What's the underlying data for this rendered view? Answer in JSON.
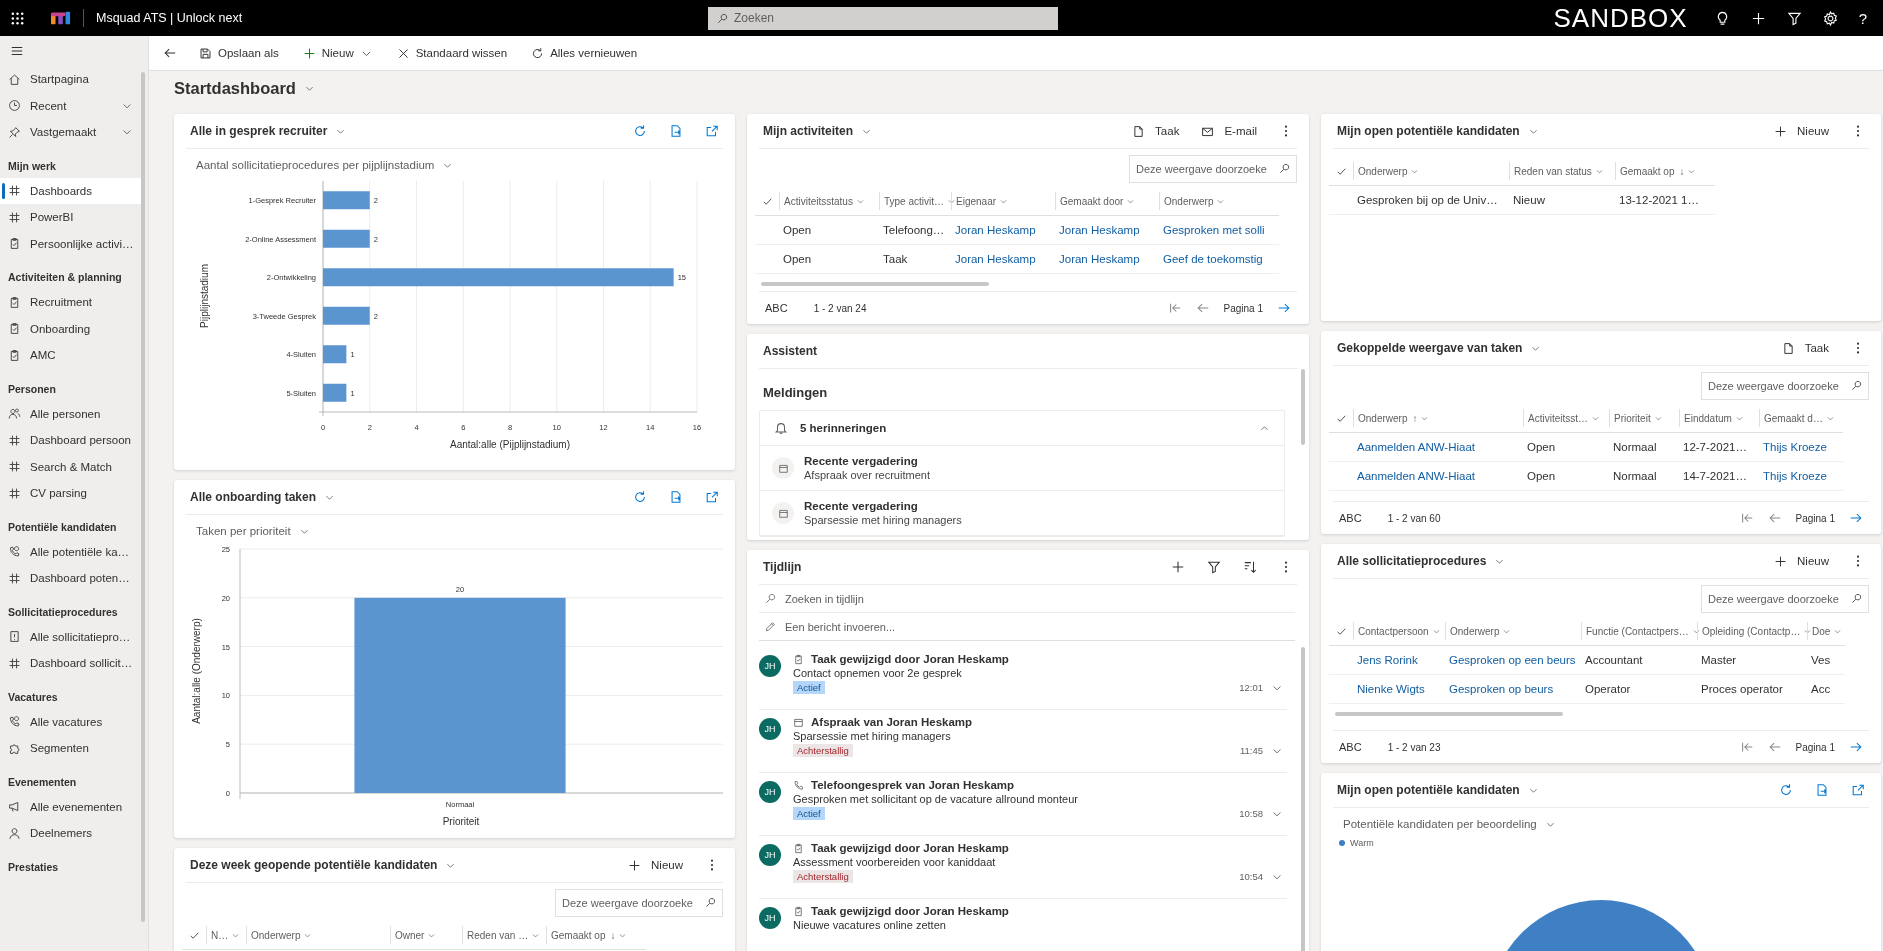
{
  "top_bar": {
    "app_name": "Msquad ATS | Unlock next",
    "search_placeholder": "Zoeken",
    "environment": "SANDBOX",
    "help": "?"
  },
  "command_bar": [
    {
      "label": "Opslaan als",
      "kind": "save",
      "has_menu": false
    },
    {
      "label": "Nieuw",
      "kind": "new",
      "has_menu": true
    },
    {
      "label": "Standaard wissen",
      "kind": "clear",
      "has_menu": false
    },
    {
      "label": "Alles vernieuwen",
      "kind": "refresh",
      "has_menu": false
    }
  ],
  "sidebar": {
    "top_items": [
      {
        "label": "Startpagina",
        "kind": "home",
        "has_menu": false
      },
      {
        "label": "Recent",
        "kind": "clock",
        "has_menu": true
      },
      {
        "label": "Vastgemaakt",
        "kind": "pin",
        "has_menu": true
      }
    ],
    "groups": [
      {
        "title": "Mijn werk",
        "items": [
          {
            "label": "Dashboards",
            "kind": "grid",
            "selected": true
          },
          {
            "label": "PowerBI",
            "kind": "grid",
            "selected": false
          },
          {
            "label": "Persoonlijke activi…",
            "kind": "clipboard",
            "selected": false
          }
        ]
      },
      {
        "title": "Activiteiten & planning",
        "items": [
          {
            "label": "Recruitment",
            "kind": "clipboard",
            "selected": false
          },
          {
            "label": "Onboarding",
            "kind": "clipboard",
            "selected": false
          },
          {
            "label": "AMC",
            "kind": "clipboard",
            "selected": false
          }
        ]
      },
      {
        "title": "Personen",
        "items": [
          {
            "label": "Alle personen",
            "kind": "people",
            "selected": false
          },
          {
            "label": "Dashboard persoon",
            "kind": "grid",
            "selected": false
          },
          {
            "label": "Search & Match",
            "kind": "grid",
            "selected": false
          },
          {
            "label": "CV parsing",
            "kind": "grid",
            "selected": false
          }
        ]
      },
      {
        "title": "Potentiële kandidaten",
        "items": [
          {
            "label": "Alle potentiële ka…",
            "kind": "contact",
            "selected": false
          },
          {
            "label": "Dashboard poten…",
            "kind": "grid",
            "selected": false
          }
        ]
      },
      {
        "title": "Sollicitatieprocedures",
        "items": [
          {
            "label": "Alle sollicitatiepro…",
            "kind": "alertdoc",
            "selected": false
          },
          {
            "label": "Dashboard sollicit…",
            "kind": "grid",
            "selected": false
          }
        ]
      },
      {
        "title": "Vacatures",
        "items": [
          {
            "label": "Alle vacatures",
            "kind": "contact",
            "selected": false
          },
          {
            "label": "Segmenten",
            "kind": "puzzle",
            "selected": false
          }
        ]
      },
      {
        "title": "Evenementen",
        "items": [
          {
            "label": "Alle evenementen",
            "kind": "megaphone",
            "selected": false
          },
          {
            "label": "Deelnemers",
            "kind": "person",
            "selected": false
          }
        ]
      },
      {
        "title": "Prestaties"
      }
    ]
  },
  "page_title": "Startdashboard",
  "columns": [
    {
      "cards": [
        {
          "kind": "chart",
          "title": "Alle in gesprek recruiter",
          "view": "Aantal sollicitatieprocedures per pijplijnstadium",
          "chart_data": {
            "type": "bar",
            "orientation": "horizontal",
            "xlabel": "Aantal:alle (Pijplijnstadium)",
            "ylabel": "Pijplijnstadium",
            "categories": [
              "1-Gesprek Recruiter",
              "2-Online Assessment",
              "2-Ontwikkeling",
              "3-Tweede Gesprek",
              "4-Sluiten",
              "5-Sluiten"
            ],
            "series": [
              {
                "color": "#5b95d0",
                "values": [
                  2,
                  2,
                  15,
                  2,
                  1,
                  1
                ]
              }
            ],
            "xlim": [
              0,
              16
            ],
            "xticks": [
              0,
              2,
              4,
              6,
              8,
              10,
              12,
              14,
              16
            ],
            "grid": true,
            "data_labels": true
          }
        },
        {
          "kind": "chart",
          "title": "Alle onboarding taken",
          "view": "Taken per prioriteit",
          "chart_data": {
            "type": "bar",
            "orientation": "vertical",
            "xlabel": "Prioriteit",
            "ylabel": "Aantal:alle (Onderwerp)",
            "categories": [
              "Normaal"
            ],
            "series": [
              {
                "color": "#5b95d0",
                "values": [
                  20
                ]
              }
            ],
            "ylim": [
              0,
              25
            ],
            "yticks": [
              0,
              5,
              10,
              15,
              20,
              25
            ],
            "grid": true,
            "data_labels": true
          }
        },
        {
          "kind": "grid",
          "title": "Deze week geopende potentiële kandidaten",
          "actions": [
            {
              "label": "Nieuw",
              "kind": "add"
            }
          ],
          "search_placeholder": "Deze weergave doorzoeke",
          "columns": [
            {
              "label": "N…"
            },
            {
              "label": "Onderwerp"
            },
            {
              "label": "Owner"
            },
            {
              "label": "Reden van …"
            },
            {
              "label": "Gemaakt op",
              "sort_mark": "↓"
            }
          ]
        }
      ]
    },
    {
      "cards": [
        {
          "kind": "grid",
          "title": "Mijn activiteiten",
          "actions": [
            {
              "label": "Taak",
              "kind": "task"
            },
            {
              "label": "E-mail",
              "kind": "email"
            }
          ],
          "search_placeholder": "Deze weergave doorzoeke",
          "columns": [
            {
              "label": "Activiteitsstatus"
            },
            {
              "label": "Type activit…"
            },
            {
              "label": "Eigenaar"
            },
            {
              "label": "Gemaakt door"
            },
            {
              "label": "Onderwerp"
            }
          ],
          "rows": [
            [
              {
                "text": "Open",
                "link": false
              },
              {
                "text": "Telefoong…",
                "link": false
              },
              {
                "text": "Joran Heskamp",
                "link": true
              },
              {
                "text": "Joran Heskamp",
                "link": true
              },
              {
                "text": "Gesproken met solli",
                "link": true
              }
            ],
            [
              {
                "text": "Open",
                "link": false
              },
              {
                "text": "Taak",
                "link": false
              },
              {
                "text": "Joran Heskamp",
                "link": true
              },
              {
                "text": "Joran Heskamp",
                "link": true
              },
              {
                "text": "Geef de toekomstig",
                "link": true
              }
            ]
          ],
          "h_scroll": true,
          "footer": {
            "jump": "ABC",
            "range": "1 - 2 van 24",
            "page": "Pagina 1"
          }
        },
        {
          "kind": "assistant",
          "title": "Assistent",
          "section": "Meldingen",
          "group": {
            "label": "5 herinneringen",
            "expanded": true
          },
          "items": [
            {
              "title": "Recente vergadering",
              "text": "Afspraak over recruitment"
            },
            {
              "title": "Recente vergadering",
              "text": "Sparsessie met hiring managers"
            }
          ]
        },
        {
          "kind": "timeline",
          "title": "Tijdlijn",
          "search_placeholder": "Zoeken in tijdlijn",
          "note_placeholder": "Een bericht invoeren...",
          "entries": [
            {
              "initials": "JH",
              "kind": "task",
              "title": "Taak gewijzigd door Joran Heskamp",
              "text": "Contact opnemen voor 2e gesprek",
              "status": {
                "label": "Actief",
                "kind": "active"
              },
              "time": "12:01"
            },
            {
              "initials": "JH",
              "kind": "appointment",
              "title": "Afspraak van Joran Heskamp",
              "text": "Sparsessie met hiring managers",
              "status": {
                "label": "Achterstallig",
                "kind": "overdue"
              },
              "time": "11:45"
            },
            {
              "initials": "JH",
              "kind": "phone",
              "title": "Telefoongesprek van Joran Heskamp",
              "text": "Gesproken met sollicitant op de vacature allround monteur",
              "status": {
                "label": "Actief",
                "kind": "active"
              },
              "time": "10:58"
            },
            {
              "initials": "JH",
              "kind": "task",
              "title": "Taak gewijzigd door Joran Heskamp",
              "text": "Assessment voorbereiden voor kaniddaat",
              "status": {
                "label": "Achterstallig",
                "kind": "overdue"
              },
              "time": "10:54"
            },
            {
              "initials": "JH",
              "kind": "task",
              "title": "Taak gewijzigd door Joran Heskamp",
              "text": "Nieuwe vacatures online zetten"
            }
          ]
        }
      ]
    },
    {
      "cards": [
        {
          "kind": "grid",
          "title": "Mijn open potentiële kandidaten",
          "actions": [
            {
              "label": "Nieuw",
              "kind": "add"
            }
          ],
          "columns": [
            {
              "label": "Onderwerp"
            },
            {
              "label": "Reden van status"
            },
            {
              "label": "Gemaakt op",
              "sort_mark": "↓"
            }
          ],
          "rows": [
            [
              {
                "text": "Gesproken bij op de Univ…",
                "link": false
              },
              {
                "text": "Nieuw",
                "link": false
              },
              {
                "text": "13-12-2021 1…",
                "link": false
              }
            ]
          ]
        },
        {
          "kind": "grid",
          "title": "Gekoppelde weergave van taken",
          "actions": [
            {
              "label": "Taak",
              "kind": "task"
            }
          ],
          "search_placeholder": "Deze weergave doorzoeke",
          "columns": [
            {
              "label": "Onderwerp",
              "sort_mark": "↑"
            },
            {
              "label": "Activiteitsst…"
            },
            {
              "label": "Prioriteit"
            },
            {
              "label": "Einddatum"
            },
            {
              "label": "Gemaakt d…"
            }
          ],
          "rows": [
            [
              {
                "text": "Aanmelden ANW-Hiaat",
                "link": true
              },
              {
                "text": "Open",
                "link": false
              },
              {
                "text": "Normaal",
                "link": false
              },
              {
                "text": "12-7-2021…",
                "link": false
              },
              {
                "text": "Thijs Kroeze",
                "link": true
              }
            ],
            [
              {
                "text": "Aanmelden ANW-Hiaat",
                "link": true
              },
              {
                "text": "Open",
                "link": false
              },
              {
                "text": "Normaal",
                "link": false
              },
              {
                "text": "14-7-2021…",
                "link": false
              },
              {
                "text": "Thijs Kroeze",
                "link": true
              }
            ]
          ],
          "footer": {
            "jump": "ABC",
            "range": "1 - 2 van 60",
            "page": "Pagina 1"
          }
        },
        {
          "kind": "grid",
          "title": "Alle sollicitatieprocedures",
          "actions": [
            {
              "label": "Nieuw",
              "kind": "add"
            }
          ],
          "search_placeholder": "Deze weergave doorzoeke",
          "columns": [
            {
              "label": "Contactpersoon"
            },
            {
              "label": "Onderwerp"
            },
            {
              "label": "Functie (Contactpers…"
            },
            {
              "label": "Opleiding (Contactp…"
            },
            {
              "label": "Doe"
            }
          ],
          "rows": [
            [
              {
                "text": "Jens Rorink",
                "link": true
              },
              {
                "text": "Gesproken op een beurs",
                "link": true
              },
              {
                "text": "Accountant",
                "link": false
              },
              {
                "text": "Master",
                "link": false
              },
              {
                "text": "Ves",
                "link": false
              }
            ],
            [
              {
                "text": "Nienke Wigts",
                "link": true
              },
              {
                "text": "Gesproken op beurs",
                "link": true
              },
              {
                "text": "Operator",
                "link": false
              },
              {
                "text": "Proces operator",
                "link": false
              },
              {
                "text": "Acc",
                "link": false
              }
            ]
          ],
          "h_scroll": true,
          "footer": {
            "jump": "ABC",
            "range": "1 - 2 van 23",
            "page": "Pagina 1"
          }
        },
        {
          "kind": "pie",
          "title": "Mijn open potentiële kandidaten",
          "view": "Potentiële kandidaten per beoordeling",
          "legend": [
            {
              "label": "Warm",
              "color": "#3f7fc4"
            }
          ]
        }
      ]
    }
  ]
}
